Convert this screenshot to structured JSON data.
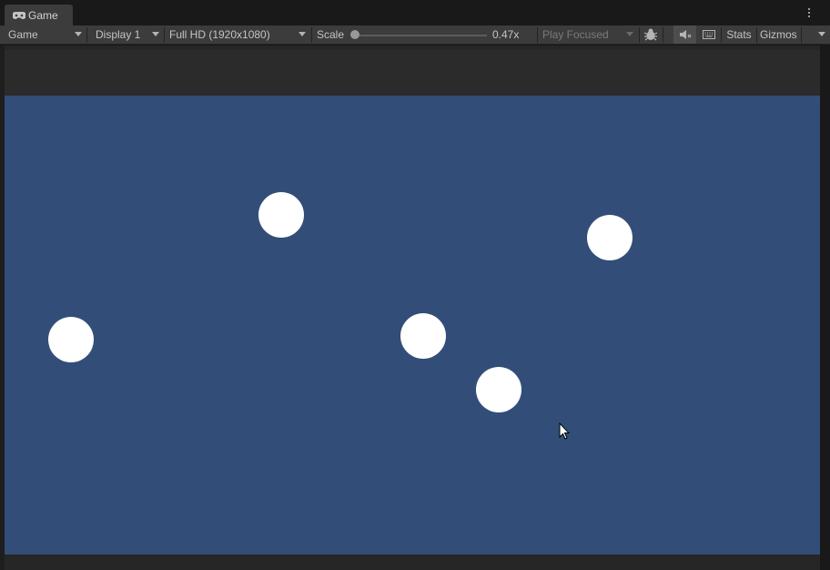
{
  "tab": {
    "title": "Game",
    "icon": "gamepad-icon"
  },
  "toolbar": {
    "mode": "Game",
    "display": "Display 1",
    "resolution": "Full HD (1920x1080)",
    "scale_label": "Scale",
    "scale_value": "0.47x",
    "scale_fraction": 0,
    "play_mode": "Play Focused",
    "stats_label": "Stats",
    "gizmos_label": "Gizmos"
  },
  "scene": {
    "background_color": "#324e78",
    "ball_color": "#ffffff",
    "ball_count": 5
  }
}
